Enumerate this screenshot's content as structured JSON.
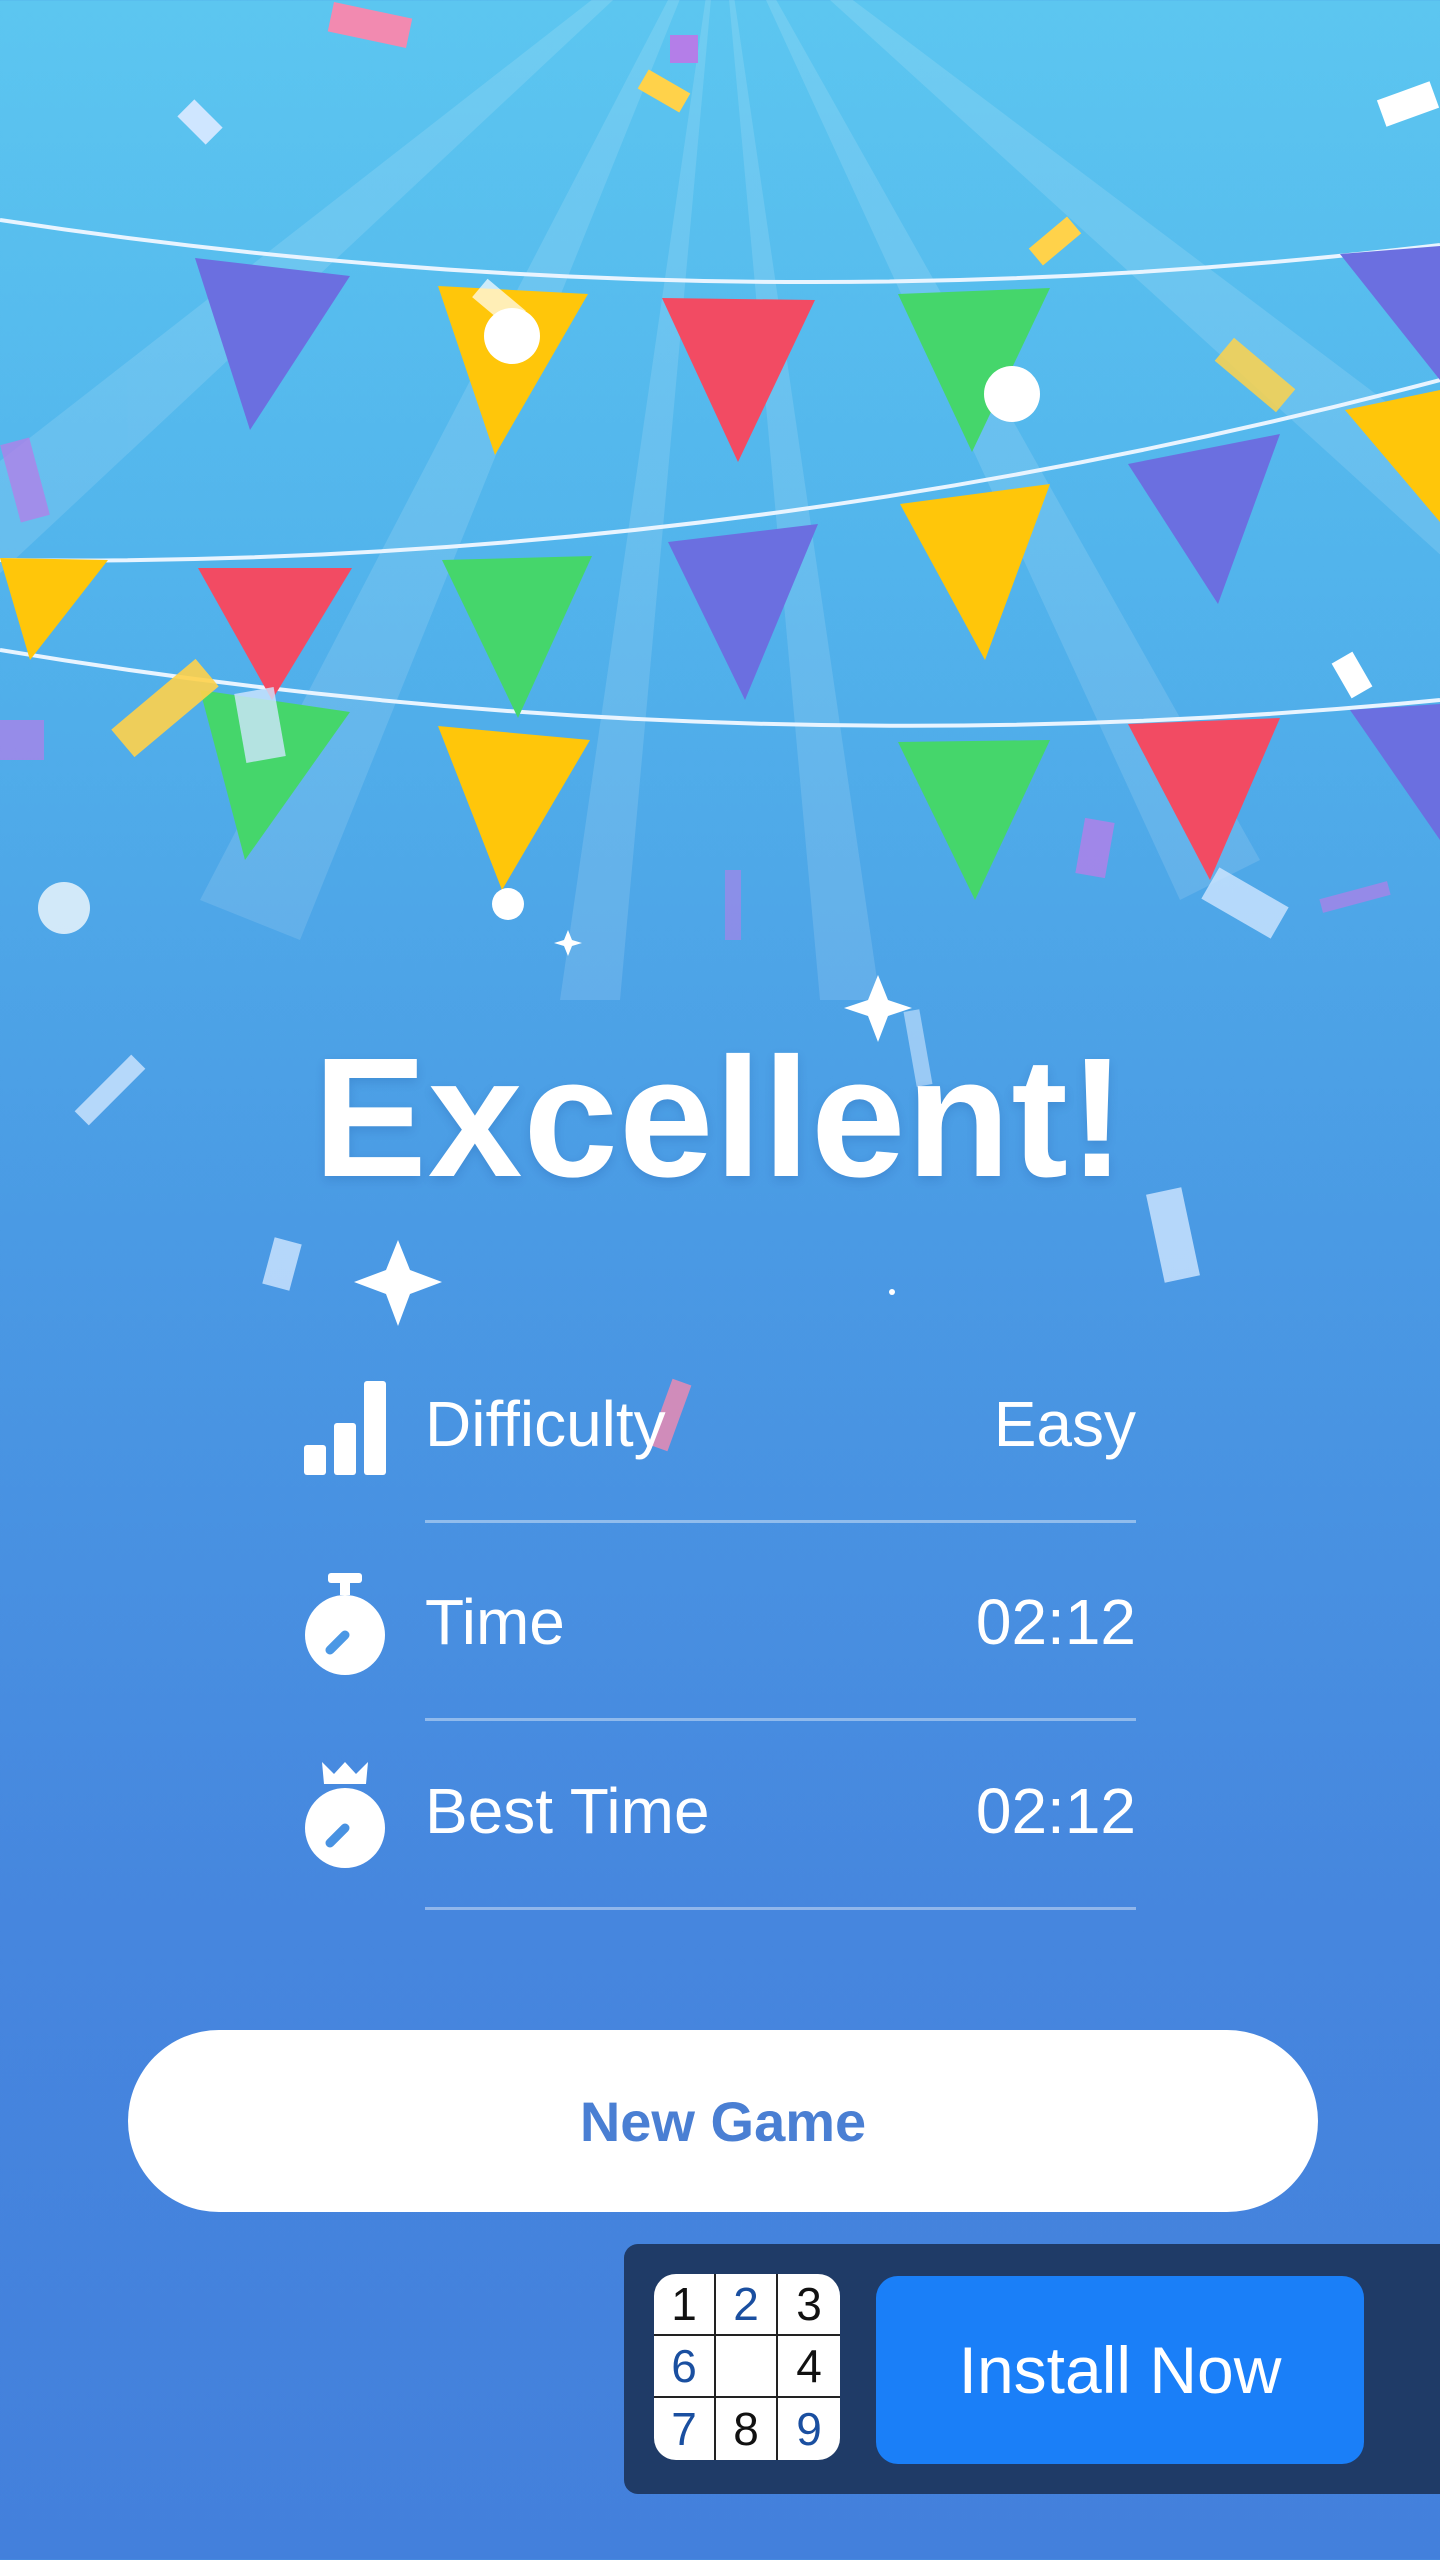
{
  "colors": {
    "background_top": "#5cc6f0",
    "background_bottom": "#4380dc",
    "button_text": "#4a7fd3",
    "ad_banner": "#1f3b67",
    "install_button": "#1a7ff8",
    "flag_purple": "#6b6fe0",
    "flag_yellow": "#ffc60a",
    "flag_red": "#f24b63",
    "flag_green": "#45d66b",
    "logo_blue_digit": "#1a4fa0"
  },
  "title": "Excellent!",
  "stats": [
    {
      "icon": "bar-chart-icon",
      "label": "Difficulty",
      "value": "Easy"
    },
    {
      "icon": "stopwatch-icon",
      "label": "Time",
      "value": "02:12"
    },
    {
      "icon": "crown-stopwatch-icon",
      "label": "Best Time",
      "value": "02:12"
    }
  ],
  "new_game_label": "New Game",
  "ad": {
    "logo_cells": [
      {
        "digit": "1",
        "color": "#111111"
      },
      {
        "digit": "2",
        "color": "#1a4fa0"
      },
      {
        "digit": "3",
        "color": "#111111"
      },
      {
        "digit": "6",
        "color": "#1a4fa0"
      },
      {
        "digit": "",
        "color": "#111111"
      },
      {
        "digit": "4",
        "color": "#111111"
      },
      {
        "digit": "7",
        "color": "#1a4fa0"
      },
      {
        "digit": "8",
        "color": "#111111"
      },
      {
        "digit": "9",
        "color": "#1a4fa0"
      }
    ],
    "install_label": "Install Now"
  }
}
